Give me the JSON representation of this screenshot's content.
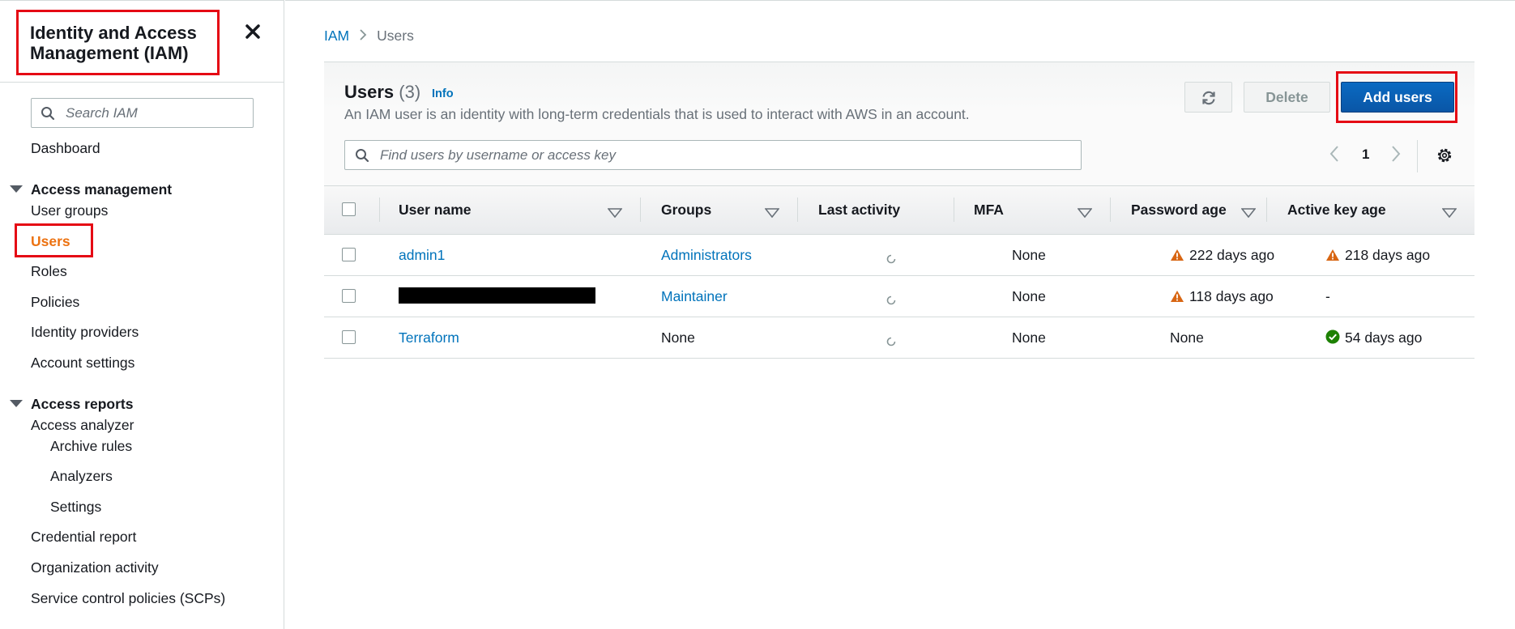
{
  "sidebar": {
    "title": "Identity and Access Management (IAM)",
    "search_placeholder": "Search IAM",
    "dashboard": "Dashboard",
    "section_access_management": "Access management",
    "user_groups": "User groups",
    "users": "Users",
    "roles": "Roles",
    "policies": "Policies",
    "identity_providers": "Identity providers",
    "account_settings": "Account settings",
    "section_access_reports": "Access reports",
    "access_analyzer": "Access analyzer",
    "archive_rules": "Archive rules",
    "analyzers": "Analyzers",
    "settings": "Settings",
    "credential_report": "Credential report",
    "organization_activity": "Organization activity",
    "scps": "Service control policies (SCPs)"
  },
  "breadcrumb": {
    "root": "IAM",
    "current": "Users"
  },
  "header": {
    "title": "Users",
    "count": "(3)",
    "info": "Info",
    "description": "An IAM user is an identity with long-term credentials that is used to interact with AWS in an account.",
    "delete_label": "Delete",
    "add_label": "Add users"
  },
  "table_search_placeholder": "Find users by username or access key",
  "pagination": {
    "current_page": "1"
  },
  "columns": {
    "user_name": "User name",
    "groups": "Groups",
    "last_activity": "Last activity",
    "mfa": "MFA",
    "password_age": "Password age",
    "active_key_age": "Active key age"
  },
  "rows": [
    {
      "user": "admin1",
      "groups": "Administrators",
      "mfa": "None",
      "password_age": "222 days ago",
      "key_age": "218 days ago"
    },
    {
      "user": "",
      "groups": "Maintainer",
      "mfa": "None",
      "password_age": "118 days ago",
      "key_age": "-"
    },
    {
      "user": "Terraform",
      "groups": "None",
      "mfa": "None",
      "password_age": "None",
      "key_age": "54 days ago"
    }
  ],
  "colors": {
    "link": "#0073bb",
    "active_nav": "#ec7211",
    "warning": "#d86613",
    "success": "#1d8102",
    "primary_button": "#0a5cb0",
    "highlight_box": "#e50914"
  }
}
